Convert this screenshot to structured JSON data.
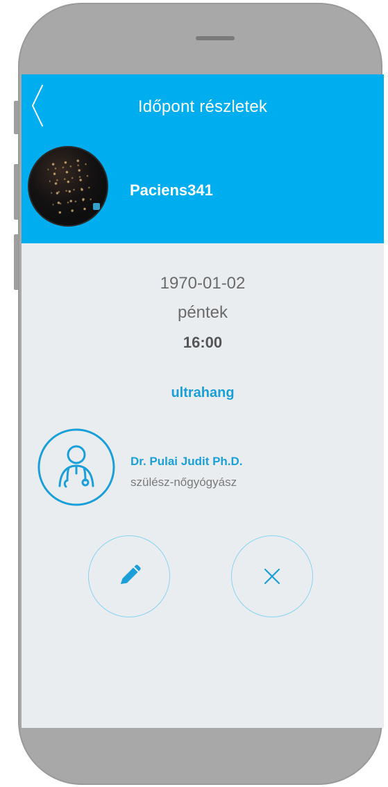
{
  "header": {
    "title": "Időpont részletek",
    "back_icon": "chevron-left-icon"
  },
  "patient": {
    "name": "Paciens341"
  },
  "appointment": {
    "date": "1970-01-02",
    "weekday": "péntek",
    "time": "16:00",
    "service": "ultrahang"
  },
  "doctor": {
    "name": "Dr. Pulai Judit Ph.D.",
    "specialty": "szülész-nőgyógyász",
    "icon": "doctor-icon"
  },
  "actions": {
    "edit_icon": "pencil-icon",
    "cancel_icon": "close-icon"
  },
  "colors": {
    "accent": "#00aeef",
    "link": "#1a9fd8",
    "background": "#eaedf0",
    "frame": "#a8a8a8"
  }
}
